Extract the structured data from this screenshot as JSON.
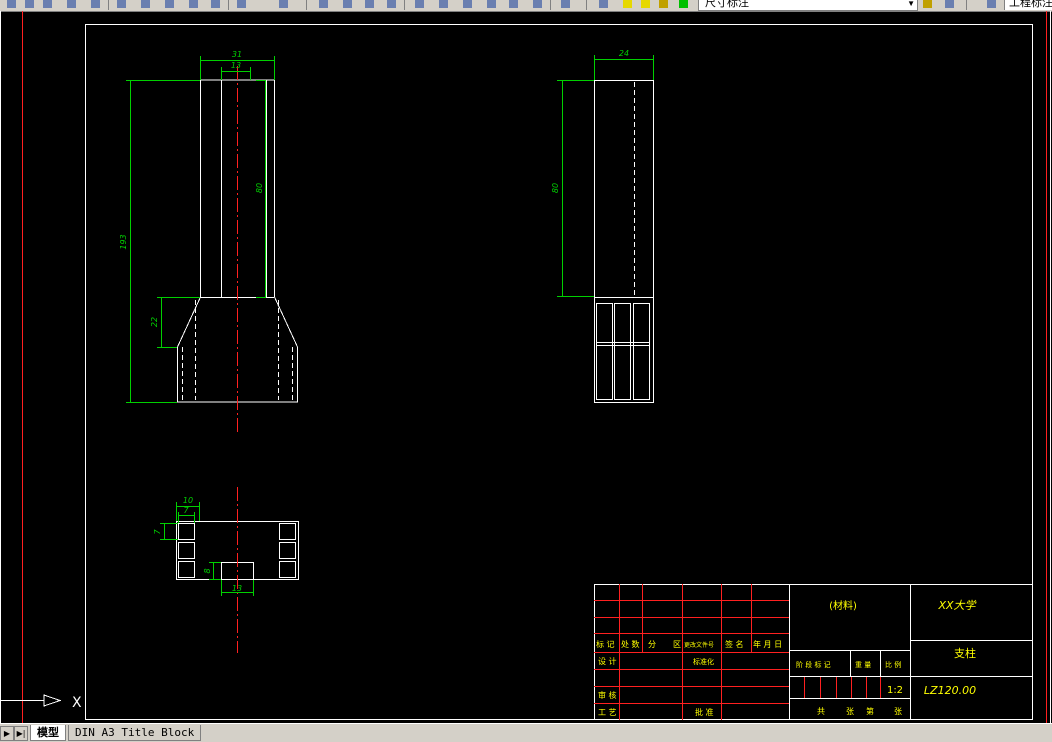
{
  "toolbar": {
    "layer_value": "尺寸标注",
    "style_value": "工程标注"
  },
  "tabs": [
    {
      "label": "模型"
    },
    {
      "label": "DIN A3 Title Block"
    }
  ],
  "drawing": {
    "dims": {
      "front_width": "31",
      "front_slot": "13",
      "front_total_height": "193",
      "front_slot_height": "80",
      "front_taper": "22",
      "side_width": "24",
      "side_height": "80",
      "top_width_outer": "10",
      "top_width_inner": "7",
      "top_row": "7",
      "top_slot_depth": "8",
      "top_slot_width": "13"
    },
    "ucs_label": "X",
    "title_block": {
      "material": "(材料)",
      "school": "XX大学",
      "part_name": "支柱",
      "scale": "1:2",
      "drawing_no": "LZ120.00",
      "rev_headers": [
        "标 记",
        "处 数",
        "分",
        "区",
        "更改文件号",
        "签 名",
        "年 月 日"
      ],
      "left_rows": [
        "设 计",
        "标准化",
        "审 核",
        "工 艺",
        "批 准"
      ],
      "mid_headers": [
        "阶 段 标 记",
        "重 量",
        "比 例"
      ],
      "sheet_labels": [
        "共",
        "张",
        "第",
        "张"
      ]
    }
  }
}
